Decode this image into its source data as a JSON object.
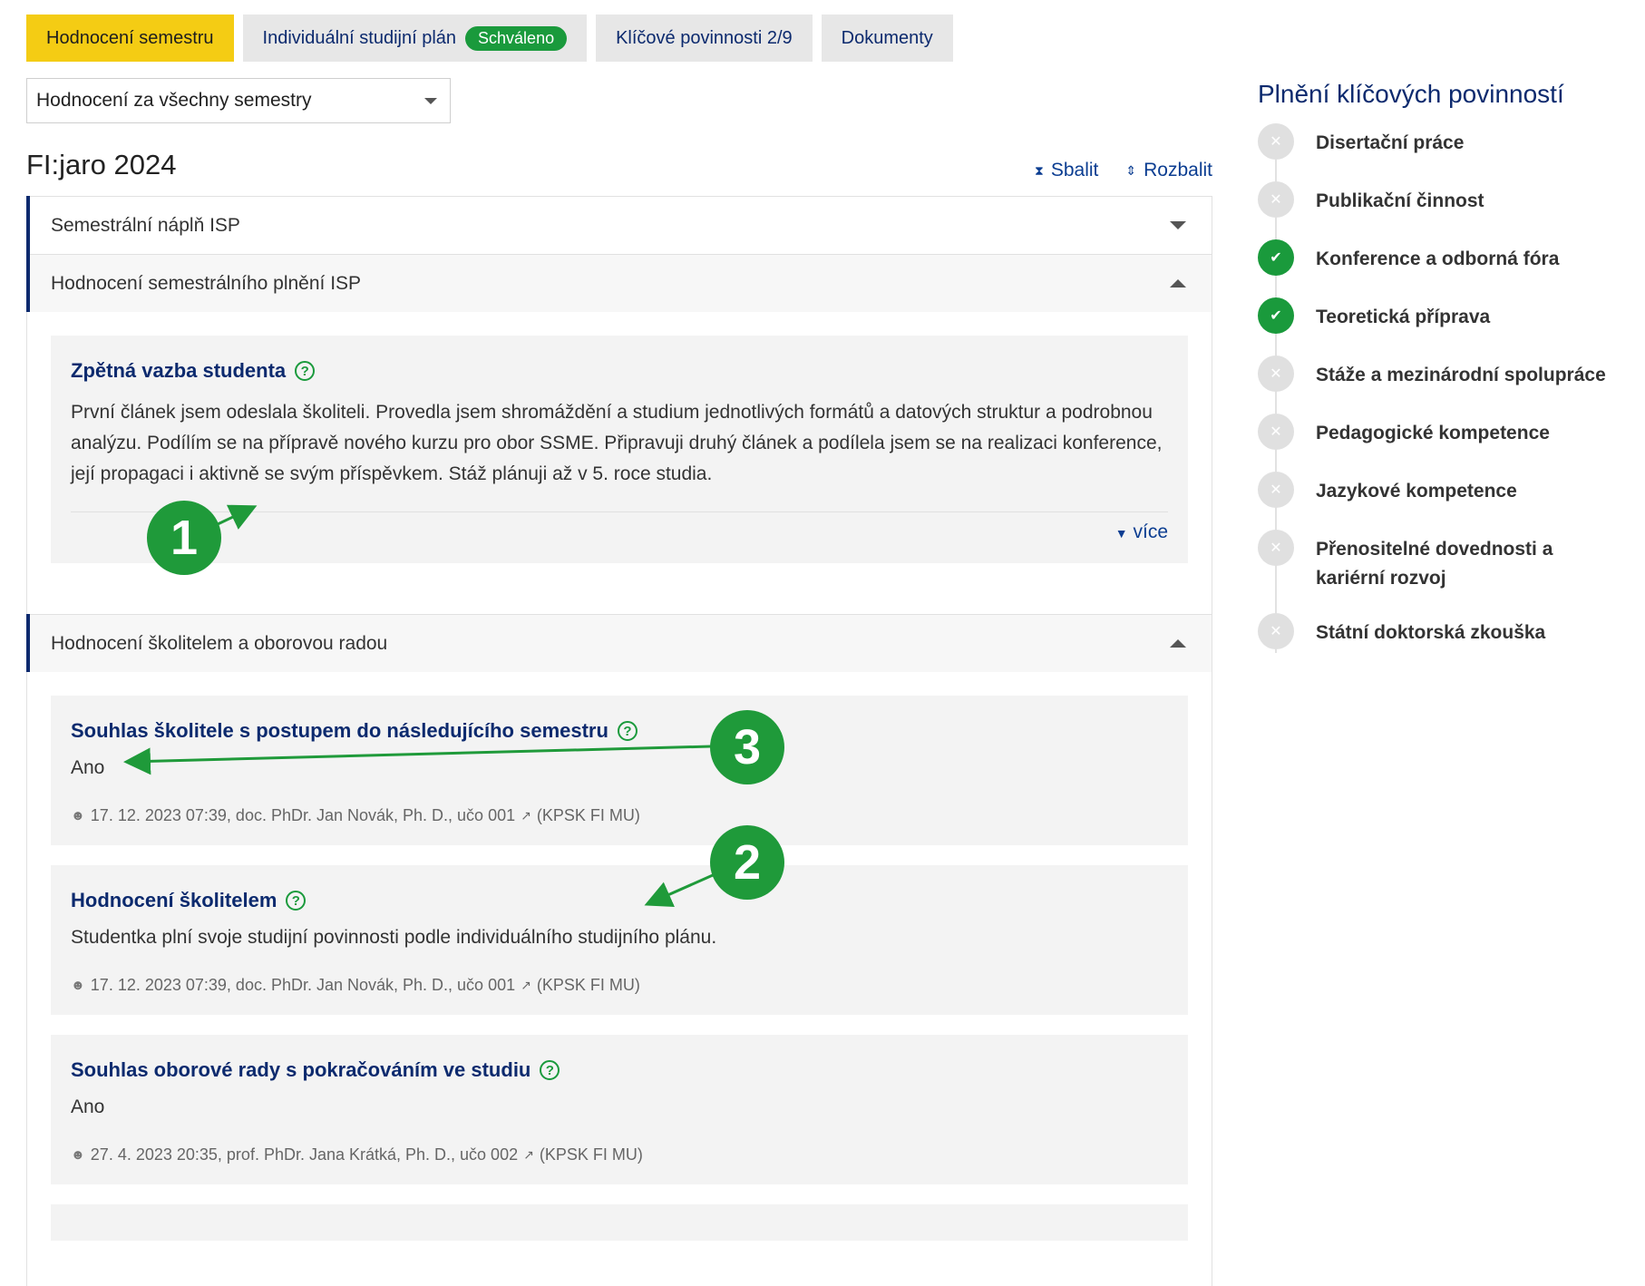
{
  "tabs": [
    {
      "label": "Hodnocení semestru",
      "active": true
    },
    {
      "label": "Individuální studijní plán",
      "badge": "Schváleno"
    },
    {
      "label": "Klíčové povinnosti 2/9"
    },
    {
      "label": "Dokumenty"
    }
  ],
  "semester_select": {
    "value": "Hodnocení za všechny semestry"
  },
  "semester_title": "FI:jaro 2024",
  "toolbar": {
    "collapse": "Sbalit",
    "expand": "Rozbalit"
  },
  "sections": {
    "isp_content": {
      "title": "Semestrální náplň ISP",
      "expanded": false
    },
    "isp_evaluation": {
      "title": "Hodnocení semestrálního plnění ISP",
      "expanded": true,
      "feedback": {
        "title": "Zpětná vazba studenta",
        "text": "První článek jsem odeslala školiteli. Provedla jsem shromáždění a studium jednotlivých formátů a datových struktur a podrobnou analýzu. Podílím se na přípravě nového kurzu pro obor SSME. Připravuji druhý článek a podílela jsem se na realizaci konference, její propagaci i aktivně se svým příspěvkem. Stáž plánuji až v 5. roce studia.",
        "more": "více"
      }
    },
    "supervisor_evaluation": {
      "title": "Hodnocení školitelem a oborovou radou",
      "expanded": true,
      "cards": [
        {
          "title": "Souhlas školitele s postupem do následujícího semestru",
          "value": "Ano",
          "meta": "17. 12. 2023 07:39, doc. PhDr. Jan Novák, Ph. D., učo 001",
          "meta_org": "(KPSK FI MU)"
        },
        {
          "title": "Hodnocení školitelem",
          "value": "Studentka plní svoje studijní povinnosti podle individuálního studijního plánu.",
          "meta": "17. 12. 2023 07:39, doc. PhDr. Jan Novák, Ph. D., učo 001",
          "meta_org": "(KPSK FI MU)"
        },
        {
          "title": "Souhlas oborové rady s pokračováním ve studiu",
          "value": "Ano",
          "meta": "27. 4. 2023 20:35, prof. PhDr. Jana Krátká, Ph. D., učo 002",
          "meta_org": "(KPSK FI MU)"
        }
      ]
    }
  },
  "callouts": [
    "1",
    "3",
    "2"
  ],
  "sidebar": {
    "title": "Plnění klíčových povinností",
    "items": [
      {
        "label": "Disertační práce",
        "status": "pending"
      },
      {
        "label": "Publikační činnost",
        "status": "pending"
      },
      {
        "label": "Konference a odborná fóra",
        "status": "done"
      },
      {
        "label": "Teoretická příprava",
        "status": "done"
      },
      {
        "label": "Stáže a mezinárodní spolupráce",
        "status": "pending"
      },
      {
        "label": "Pedagogické kompetence",
        "status": "pending"
      },
      {
        "label": "Jazykové kompetence",
        "status": "pending"
      },
      {
        "label": "Přenositelné dovednosti a kariérní rozvoj",
        "status": "pending"
      },
      {
        "label": "Státní doktorská zkouška",
        "status": "pending"
      }
    ]
  },
  "colors": {
    "accent_yellow": "#f4cc14",
    "brand_navy": "#0c2a6e",
    "success_green": "#1a9a3c"
  }
}
